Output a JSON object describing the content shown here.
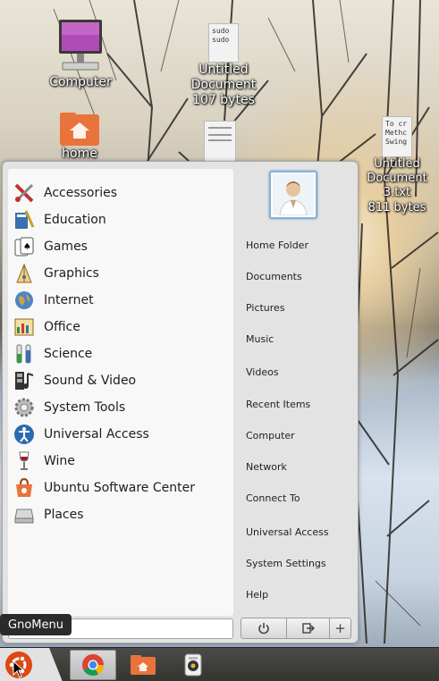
{
  "desktop": {
    "icons": [
      {
        "label": "Computer"
      },
      {
        "label": "Untitled Document",
        "sub": "107 bytes",
        "thumb_text": "sudo\nsudo"
      },
      {
        "label": "home"
      },
      {
        "label": "Untitled Document 3.txt",
        "sub": "811 bytes",
        "thumb_text": "To cr\nMethc\nSwing"
      }
    ]
  },
  "menu": {
    "categories": [
      {
        "label": "Accessories",
        "icon": "accessories-icon"
      },
      {
        "label": "Education",
        "icon": "education-icon"
      },
      {
        "label": "Games",
        "icon": "games-icon"
      },
      {
        "label": "Graphics",
        "icon": "graphics-icon"
      },
      {
        "label": "Internet",
        "icon": "internet-icon"
      },
      {
        "label": "Office",
        "icon": "office-icon"
      },
      {
        "label": "Science",
        "icon": "science-icon"
      },
      {
        "label": "Sound & Video",
        "icon": "sound-video-icon"
      },
      {
        "label": "System Tools",
        "icon": "system-tools-icon"
      },
      {
        "label": "Universal Access",
        "icon": "universal-access-icon"
      },
      {
        "label": "Wine",
        "icon": "wine-icon"
      },
      {
        "label": "Ubuntu Software Center",
        "icon": "software-center-icon"
      },
      {
        "label": "Places",
        "icon": "places-icon"
      }
    ],
    "places": [
      "Home Folder",
      "Documents",
      "Pictures",
      "Music",
      "Videos",
      "Recent Items",
      "Computer",
      "Network",
      "Connect To",
      "Universal Access",
      "System Settings",
      "Help"
    ],
    "search_value": "",
    "buttons": {
      "power": "power-icon",
      "logout": "logout-icon",
      "add": "+"
    }
  },
  "tooltip": {
    "text": "GnoMenu"
  },
  "taskbar": {
    "items": [
      "ubuntu-logo-icon",
      "chrome-icon",
      "folder-icon",
      "audio-player-icon"
    ]
  },
  "colors": {
    "menu_bg": "#e3e3e3",
    "panel_bg": "#f8f8f8",
    "ubuntu_orange": "#dd4814",
    "folder_orange": "#e8743b"
  }
}
